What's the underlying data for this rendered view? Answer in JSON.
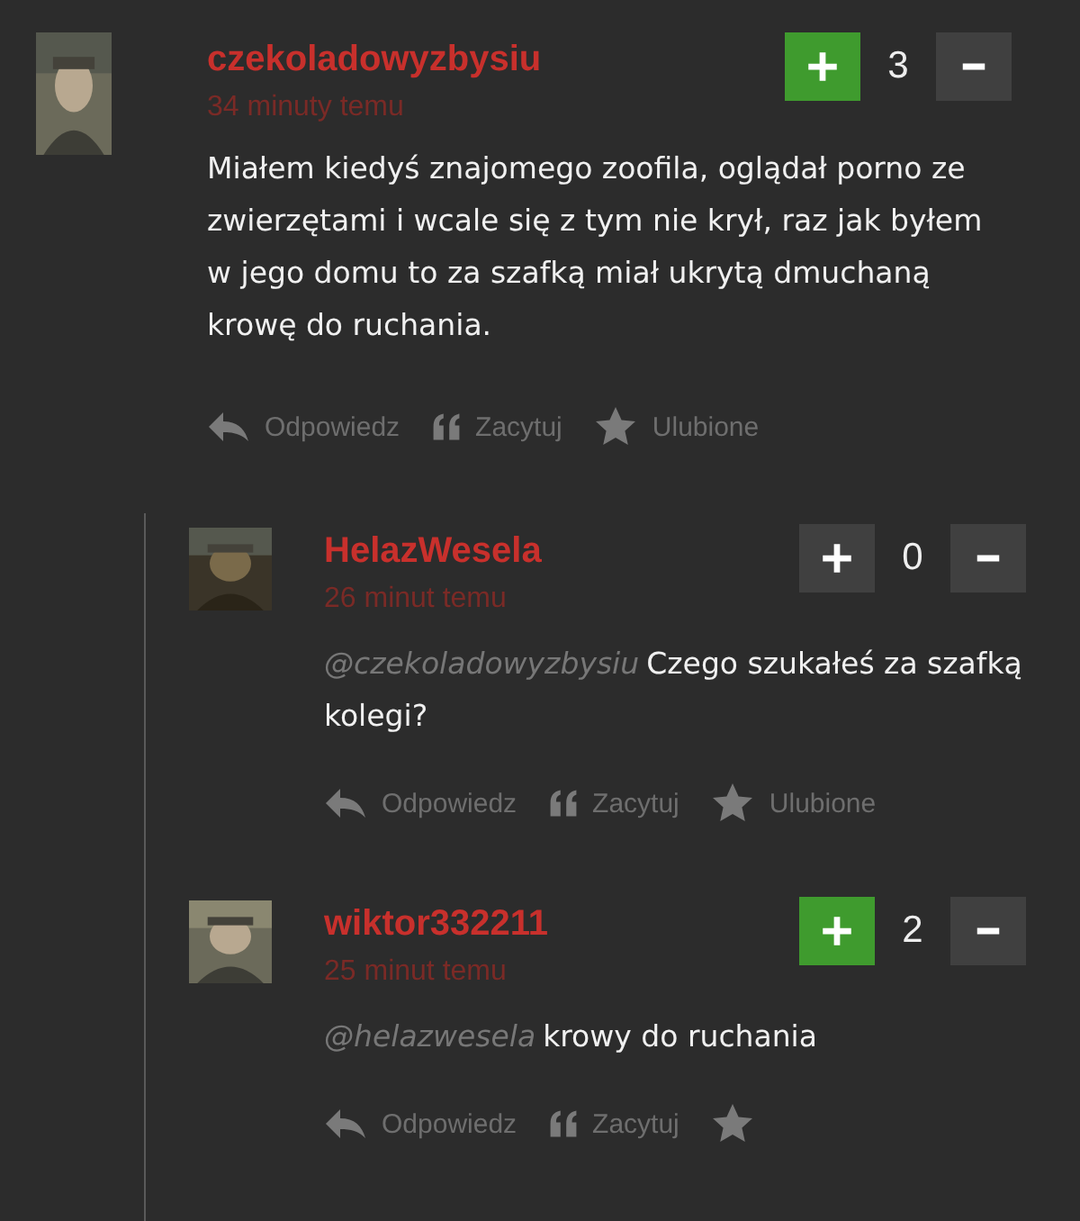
{
  "comments": [
    {
      "username": "czekoladowyzbysiu",
      "time": "34 minuty temu",
      "upvoted": true,
      "score": "3",
      "body": "Miałem kiedyś znajomego zoofila, oglądał porno ze zwierzętami i wcale się z tym nie krył, raz jak byłem w jego domu to za szafką miał ukrytą dmuchaną krowę do ruchania.",
      "actions": [
        "Odpowiedz",
        "Zacytuj",
        "Ulubione"
      ]
    },
    {
      "username": "HelazWesela",
      "time": "26 minut temu",
      "upvoted": false,
      "score": "0",
      "mention": "@czekoladowyzbysiu",
      "body": "Czego szukałeś za szafką kolegi?",
      "actions": [
        "Odpowiedz",
        "Zacytuj",
        "Ulubione"
      ]
    },
    {
      "username": "wiktor332211",
      "time": "25 minut temu",
      "upvoted": true,
      "score": "2",
      "mention": "@helazwesela",
      "body": "krowy do ruchania",
      "actions": [
        "Odpowiedz",
        "Zacytuj"
      ]
    }
  ]
}
